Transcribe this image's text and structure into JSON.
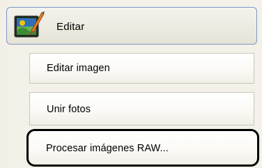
{
  "panel": {
    "header": {
      "label": "Editar",
      "icon": "edit-image-icon"
    },
    "items": [
      {
        "label": "Editar imagen"
      },
      {
        "label": "Unir fotos"
      },
      {
        "label": "Procesar imágenes RAW..."
      }
    ],
    "colors": {
      "header_border": "#7a96c8",
      "highlight_border": "#000000",
      "panel_bg": "#f4f2e8"
    }
  }
}
